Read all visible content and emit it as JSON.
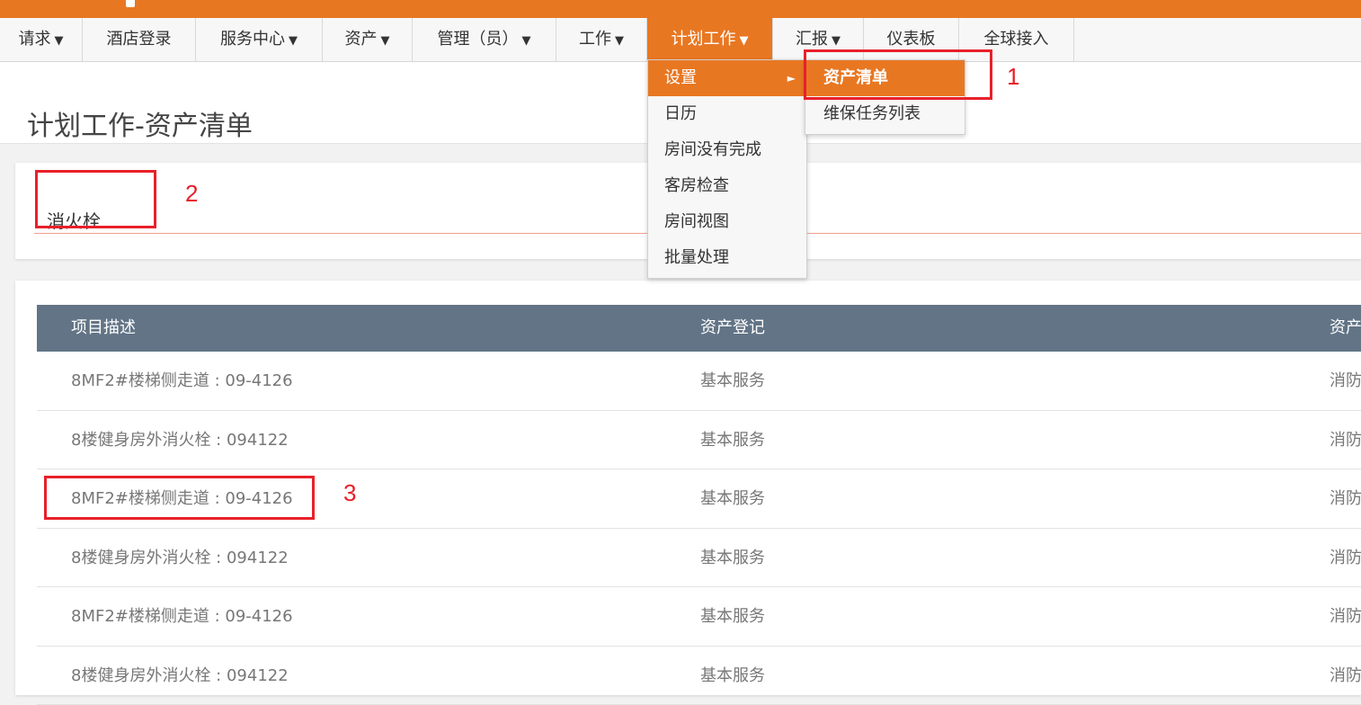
{
  "nav": {
    "items": [
      {
        "label": "请求",
        "caret": "▼"
      },
      {
        "label": "酒店登录",
        "caret": ""
      },
      {
        "label": "服务中心",
        "caret": "▼"
      },
      {
        "label": "资产",
        "caret": "▼"
      },
      {
        "label": "管理（员）",
        "caret": "▼"
      },
      {
        "label": "工作",
        "caret": "▼"
      },
      {
        "label": "计划工作",
        "caret": "▼"
      },
      {
        "label": "汇报",
        "caret": "▼"
      },
      {
        "label": "仪表板",
        "caret": ""
      },
      {
        "label": "全球接入",
        "caret": ""
      }
    ]
  },
  "dropdown": {
    "items": [
      {
        "label": "设置",
        "arrow": "►"
      },
      {
        "label": "日历"
      },
      {
        "label": "房间没有完成"
      },
      {
        "label": "客房检查"
      },
      {
        "label": "房间视图"
      },
      {
        "label": "批量处理"
      }
    ]
  },
  "submenu": {
    "items": [
      {
        "label": "资产清单"
      },
      {
        "label": "维保任务列表"
      }
    ]
  },
  "page": {
    "title": "计划工作-资产清单"
  },
  "filter": {
    "value": "消火栓"
  },
  "table": {
    "headers": [
      "项目描述",
      "资产登记",
      "资产"
    ],
    "rows": [
      {
        "desc": "8MF2#楼梯侧走道 : 09-4126",
        "register": "基本服务",
        "type": "消防"
      },
      {
        "desc": "8楼健身房外消火栓 : 094122",
        "register": "基本服务",
        "type": "消防"
      },
      {
        "desc": "8MF2#楼梯侧走道 : 09-4126",
        "register": "基本服务",
        "type": "消防"
      },
      {
        "desc": "8楼健身房外消火栓 : 094122",
        "register": "基本服务",
        "type": "消防"
      },
      {
        "desc": "8MF2#楼梯侧走道 : 09-4126",
        "register": "基本服务",
        "type": "消防"
      },
      {
        "desc": "8楼健身房外消火栓 : 094122",
        "register": "基本服务",
        "type": "消防"
      }
    ]
  },
  "annotations": [
    "1",
    "2",
    "3"
  ],
  "colors": {
    "accent": "#e87722",
    "header": "#627486",
    "annotation": "#e8202a"
  }
}
